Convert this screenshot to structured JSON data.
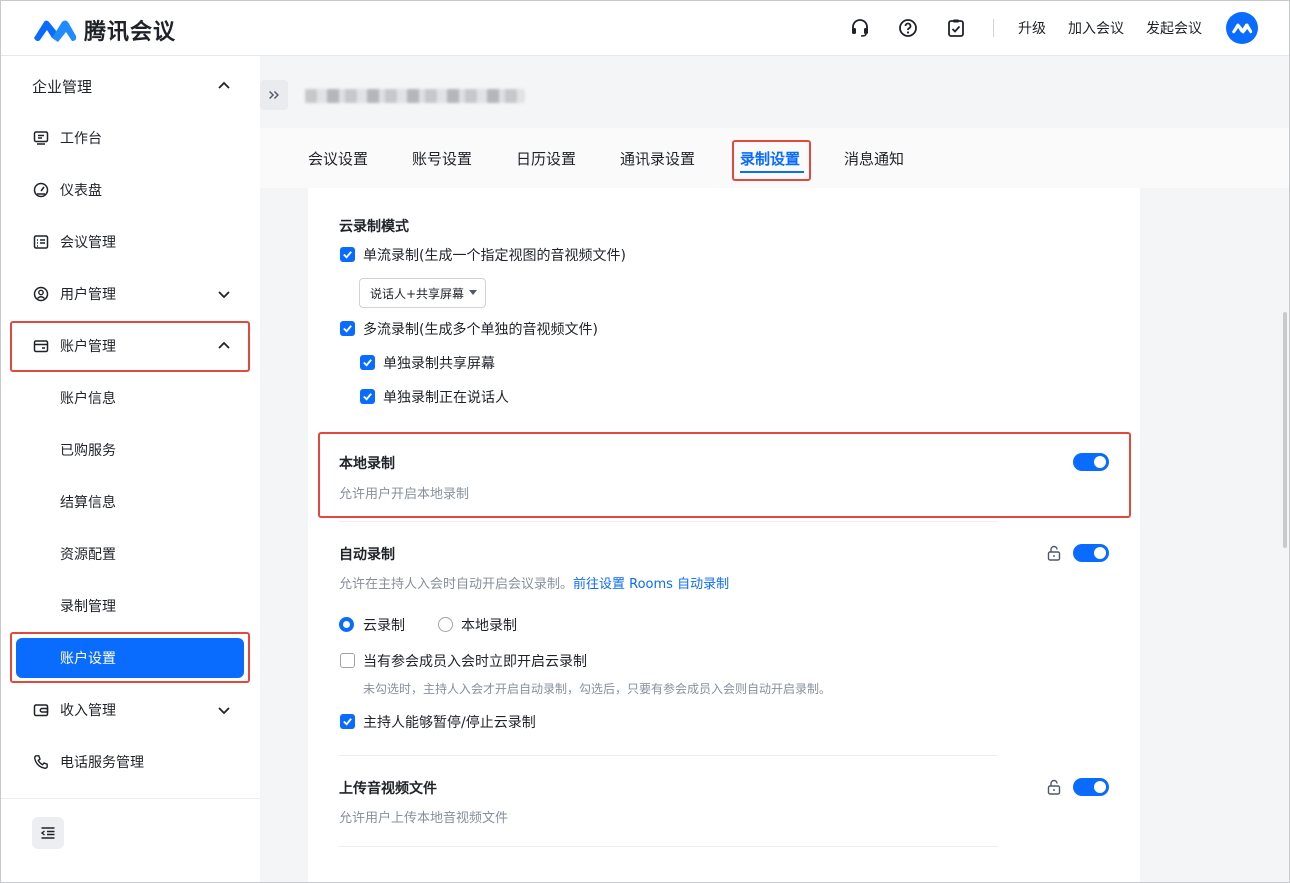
{
  "header": {
    "app_name": "腾讯会议",
    "upgrade": "升级",
    "join_meeting": "加入会议",
    "start_meeting": "发起会议"
  },
  "sidebar": {
    "section_title": "企业管理",
    "items": {
      "workbench": "工作台",
      "dashboard": "仪表盘",
      "meeting_mgmt": "会议管理",
      "user_mgmt": "用户管理",
      "account_mgmt": "账户管理",
      "account_info": "账户信息",
      "purchased": "已购服务",
      "billing": "结算信息",
      "resources": "资源配置",
      "recording_mgmt": "录制管理",
      "account_settings": "账户设置",
      "income_mgmt": "收入管理",
      "phone_service": "电话服务管理"
    }
  },
  "tabs": {
    "meeting": "会议设置",
    "account": "账号设置",
    "calendar": "日历设置",
    "contacts": "通讯录设置",
    "recording": "录制设置",
    "notifications": "消息通知"
  },
  "cloud": {
    "title": "云录制模式",
    "single_stream": "单流录制(生成一个指定视图的音视频文件)",
    "view_select": "说话人+共享屏幕",
    "multi_stream": "多流录制(生成多个单独的音视频文件)",
    "record_share": "单独录制共享屏幕",
    "record_speaker": "单独录制正在说话人"
  },
  "local": {
    "title": "本地录制",
    "desc": "允许用户开启本地录制"
  },
  "auto": {
    "title": "自动录制",
    "desc": "允许在主持人入会时自动开启会议录制。",
    "link": "前往设置 Rooms 自动录制",
    "radio_cloud": "云录制",
    "radio_local": "本地录制",
    "on_member_join": "当有参会成员入会时立即开启云录制",
    "on_member_join_desc": "未勾选时，主持人入会才开启自动录制，勾选后，只要有参会成员入会则自动开启录制。",
    "host_pause": "主持人能够暂停/停止云录制"
  },
  "upload": {
    "title": "上传音视频文件",
    "desc": "允许用户上传本地音视频文件"
  },
  "colors": {
    "accent": "#0a6cff",
    "highlight": "#e2483c"
  }
}
